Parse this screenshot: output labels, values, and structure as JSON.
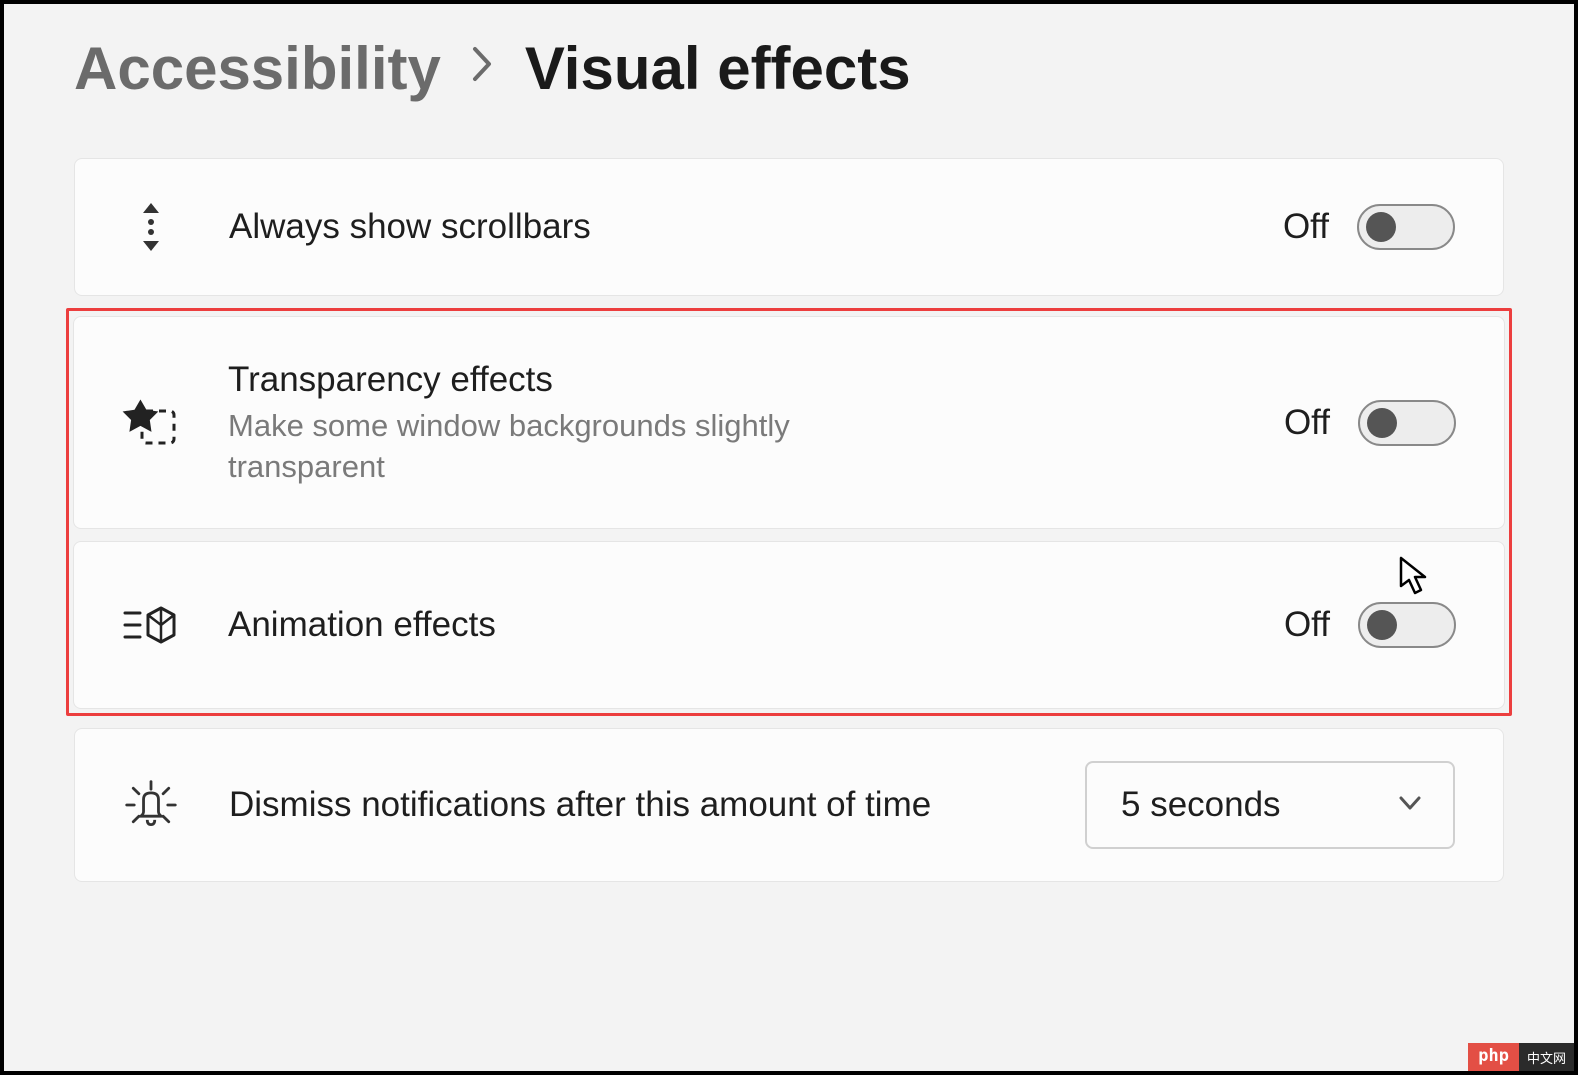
{
  "breadcrumb": {
    "parent": "Accessibility",
    "current": "Visual effects"
  },
  "settings": {
    "scrollbars": {
      "title": "Always show scrollbars",
      "state": "Off"
    },
    "transparency": {
      "title": "Transparency effects",
      "desc": "Make some window backgrounds slightly transparent",
      "state": "Off"
    },
    "animation": {
      "title": "Animation effects",
      "state": "Off"
    },
    "dismiss": {
      "title": "Dismiss notifications after this amount of time",
      "value": "5 seconds"
    }
  },
  "badge": {
    "left": "php",
    "right": "中文网"
  }
}
